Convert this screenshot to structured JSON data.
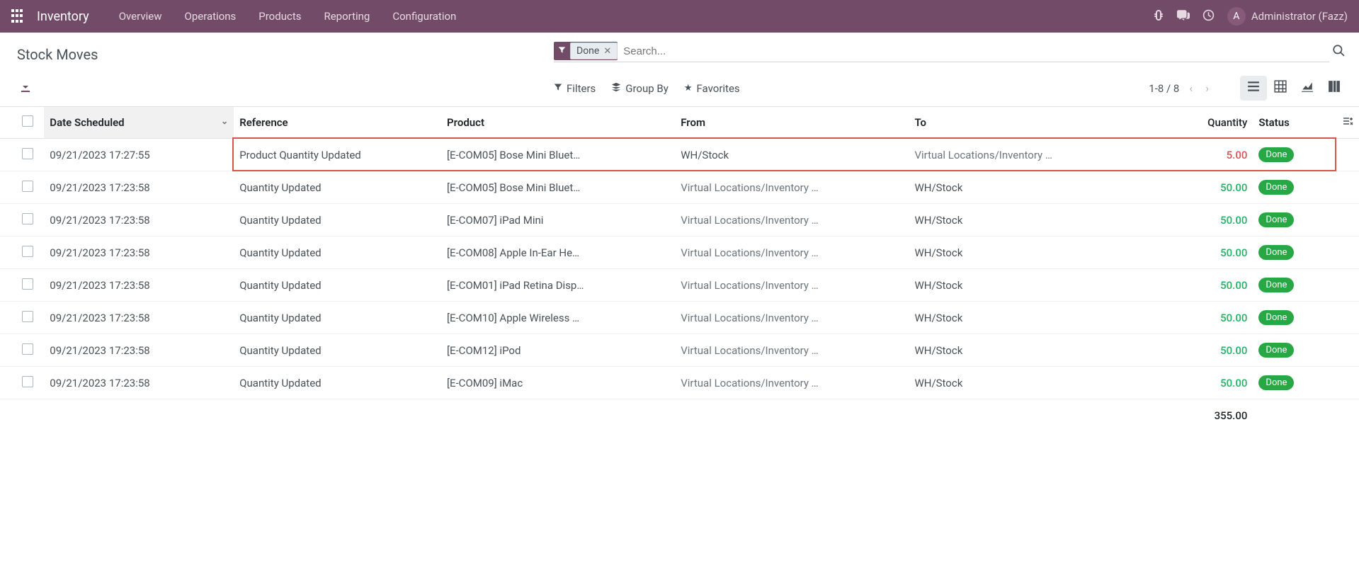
{
  "navbar": {
    "brand": "Inventory",
    "links": [
      "Overview",
      "Operations",
      "Products",
      "Reporting",
      "Configuration"
    ],
    "user": {
      "initial": "A",
      "name": "Administrator (Fazz)"
    }
  },
  "page_title": "Stock Moves",
  "search": {
    "filter_chip": "Done",
    "placeholder": "Search..."
  },
  "toolbar": {
    "filters": "Filters",
    "group_by": "Group By",
    "favorites": "Favorites",
    "pager": "1-8 / 8"
  },
  "columns": {
    "date": "Date Scheduled",
    "reference": "Reference",
    "product": "Product",
    "from": "From",
    "to": "To",
    "quantity": "Quantity",
    "status": "Status"
  },
  "rows": [
    {
      "date": "09/21/2023 17:27:55",
      "ref": "Product Quantity Updated",
      "product": "[E-COM05] Bose Mini Bluet…",
      "from": "WH/Stock",
      "from_muted": false,
      "to": "Virtual Locations/Inventory …",
      "to_muted": true,
      "qty": "5.00",
      "qty_class": "qty-red",
      "status": "Done",
      "highlighted": true
    },
    {
      "date": "09/21/2023 17:23:58",
      "ref": "Quantity Updated",
      "product": "[E-COM05] Bose Mini Bluet…",
      "from": "Virtual Locations/Inventory …",
      "from_muted": true,
      "to": "WH/Stock",
      "to_muted": false,
      "qty": "50.00",
      "qty_class": "qty-green",
      "status": "Done",
      "highlighted": false
    },
    {
      "date": "09/21/2023 17:23:58",
      "ref": "Quantity Updated",
      "product": "[E-COM07] iPad Mini",
      "from": "Virtual Locations/Inventory …",
      "from_muted": true,
      "to": "WH/Stock",
      "to_muted": false,
      "qty": "50.00",
      "qty_class": "qty-green",
      "status": "Done",
      "highlighted": false
    },
    {
      "date": "09/21/2023 17:23:58",
      "ref": "Quantity Updated",
      "product": "[E-COM08] Apple In-Ear He…",
      "from": "Virtual Locations/Inventory …",
      "from_muted": true,
      "to": "WH/Stock",
      "to_muted": false,
      "qty": "50.00",
      "qty_class": "qty-green",
      "status": "Done",
      "highlighted": false
    },
    {
      "date": "09/21/2023 17:23:58",
      "ref": "Quantity Updated",
      "product": "[E-COM01] iPad Retina Disp…",
      "from": "Virtual Locations/Inventory …",
      "from_muted": true,
      "to": "WH/Stock",
      "to_muted": false,
      "qty": "50.00",
      "qty_class": "qty-green",
      "status": "Done",
      "highlighted": false
    },
    {
      "date": "09/21/2023 17:23:58",
      "ref": "Quantity Updated",
      "product": "[E-COM10] Apple Wireless …",
      "from": "Virtual Locations/Inventory …",
      "from_muted": true,
      "to": "WH/Stock",
      "to_muted": false,
      "qty": "50.00",
      "qty_class": "qty-green",
      "status": "Done",
      "highlighted": false
    },
    {
      "date": "09/21/2023 17:23:58",
      "ref": "Quantity Updated",
      "product": "[E-COM12] iPod",
      "from": "Virtual Locations/Inventory …",
      "from_muted": true,
      "to": "WH/Stock",
      "to_muted": false,
      "qty": "50.00",
      "qty_class": "qty-green",
      "status": "Done",
      "highlighted": false
    },
    {
      "date": "09/21/2023 17:23:58",
      "ref": "Quantity Updated",
      "product": "[E-COM09] iMac",
      "from": "Virtual Locations/Inventory …",
      "from_muted": true,
      "to": "WH/Stock",
      "to_muted": false,
      "qty": "50.00",
      "qty_class": "qty-green",
      "status": "Done",
      "highlighted": false
    }
  ],
  "total_qty": "355.00"
}
